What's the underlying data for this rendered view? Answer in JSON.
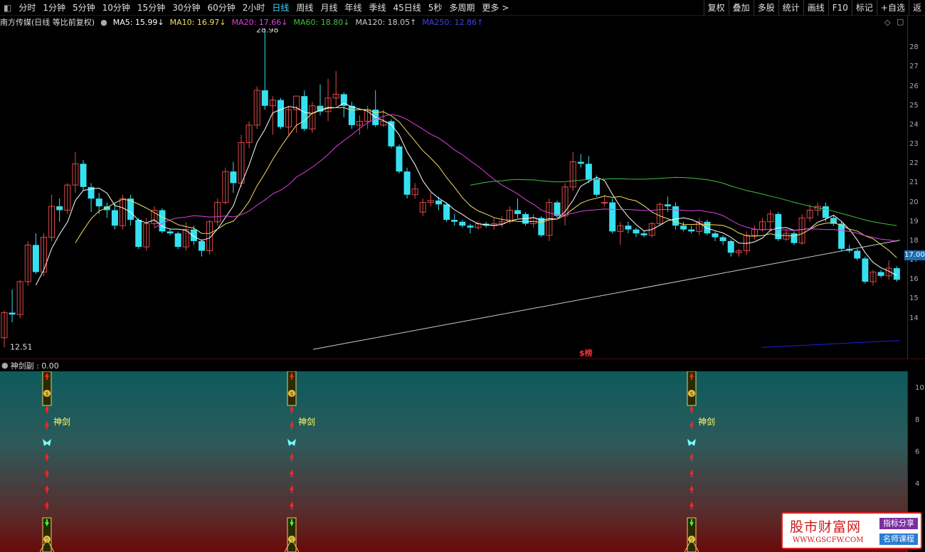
{
  "toolbar": {
    "periods": [
      "分时",
      "1分钟",
      "5分钟",
      "10分钟",
      "15分钟",
      "30分钟",
      "60分钟",
      "2小时",
      "日线",
      "周线",
      "月线",
      "年线",
      "季线",
      "45日线",
      "5秒",
      "多周期",
      "更多 >"
    ],
    "active": "日线",
    "right_buttons": [
      "复权",
      "叠加",
      "多股",
      "统计",
      "画线",
      "F10",
      "标记",
      "+自选",
      "返"
    ]
  },
  "legend": {
    "title": "南方传媒(日线 等比前复权)",
    "ma5": "MA5: 15.99↓",
    "ma10": "MA10: 16.97↓",
    "ma20": "MA20: 17.66↓",
    "ma60": "MA60: 18.80↓",
    "ma120": "MA120: 18.05↑",
    "ma250": "MA250: 12.86↑"
  },
  "colors": {
    "up": "#e04848",
    "down": "#36e0f0",
    "ma5": "#ffffff",
    "ma10": "#f0e060",
    "ma20": "#e040e0",
    "ma60": "#40c040",
    "ma120": "#cccccc",
    "ma250": "#2020e0"
  },
  "chart": {
    "high_label": "28.98",
    "low_label": "12.51",
    "current_price": "17.00",
    "event_marker": "$榜",
    "yaxis_ticks": [
      "28",
      "27",
      "26",
      "25",
      "24",
      "23",
      "22",
      "21",
      "20",
      "19",
      "18",
      "17",
      "16",
      "15",
      "14"
    ]
  },
  "sub": {
    "title": "神剑副 : 0.00",
    "sword_label": "神剑",
    "yaxis_ticks": [
      "10",
      "8",
      "6",
      "4"
    ]
  },
  "watermark": {
    "title": "股市财富网",
    "url": "WWW.GSCFW.COM",
    "tag1": "指标分享",
    "tag2": "名师课程"
  },
  "chart_data": {
    "type": "candlestick",
    "ylim": [
      12,
      29
    ],
    "candles": [
      [
        13.0,
        14.4,
        12.5,
        14.3
      ],
      [
        14.3,
        15.5,
        13.8,
        14.2
      ],
      [
        14.2,
        16.0,
        14.0,
        15.9
      ],
      [
        15.9,
        18.0,
        15.7,
        17.8
      ],
      [
        17.8,
        18.4,
        16.3,
        16.4
      ],
      [
        16.4,
        18.4,
        16.2,
        18.2
      ],
      [
        18.2,
        20.4,
        18.0,
        19.8
      ],
      [
        19.8,
        20.2,
        19.0,
        19.6
      ],
      [
        19.6,
        21.0,
        19.4,
        20.9
      ],
      [
        20.9,
        22.6,
        20.5,
        22.0
      ],
      [
        22.0,
        22.2,
        20.6,
        20.8
      ],
      [
        20.8,
        21.0,
        19.5,
        20.2
      ],
      [
        20.2,
        20.5,
        19.4,
        19.8
      ],
      [
        19.8,
        20.0,
        19.2,
        19.6
      ],
      [
        19.6,
        20.0,
        18.6,
        18.8
      ],
      [
        18.8,
        20.4,
        18.6,
        20.2
      ],
      [
        20.2,
        20.4,
        18.8,
        19.1
      ],
      [
        19.1,
        19.2,
        17.6,
        17.7
      ],
      [
        17.7,
        19.2,
        17.5,
        18.9
      ],
      [
        18.9,
        19.8,
        18.7,
        19.6
      ],
      [
        19.6,
        19.7,
        18.4,
        18.5
      ],
      [
        18.5,
        18.6,
        18.3,
        18.4
      ],
      [
        18.4,
        18.5,
        17.6,
        17.7
      ],
      [
        17.7,
        19.0,
        17.5,
        18.6
      ],
      [
        18.6,
        18.8,
        17.8,
        18.0
      ],
      [
        18.0,
        18.1,
        17.2,
        17.5
      ],
      [
        17.5,
        19.1,
        17.3,
        19.0
      ],
      [
        19.0,
        20.2,
        18.8,
        20.0
      ],
      [
        20.0,
        21.8,
        19.9,
        21.6
      ],
      [
        21.6,
        22.1,
        20.5,
        21.0
      ],
      [
        21.0,
        23.5,
        20.8,
        23.1
      ],
      [
        23.1,
        24.2,
        22.8,
        24.0
      ],
      [
        24.0,
        26.0,
        23.8,
        25.8
      ],
      [
        25.8,
        29.0,
        24.8,
        25.0
      ],
      [
        25.0,
        25.5,
        23.5,
        25.3
      ],
      [
        25.3,
        25.4,
        23.8,
        23.9
      ],
      [
        23.9,
        25.0,
        23.5,
        24.8
      ],
      [
        24.8,
        25.0,
        23.6,
        25.5
      ],
      [
        25.5,
        25.8,
        23.7,
        23.8
      ],
      [
        23.8,
        25.2,
        23.6,
        25.0
      ],
      [
        25.0,
        26.1,
        24.5,
        24.7
      ],
      [
        24.7,
        26.4,
        24.2,
        25.4
      ],
      [
        25.4,
        26.8,
        25.0,
        25.6
      ],
      [
        25.6,
        25.7,
        24.4,
        25.0
      ],
      [
        25.0,
        25.2,
        23.8,
        24.0
      ],
      [
        24.0,
        24.5,
        23.5,
        24.2
      ],
      [
        24.2,
        25.0,
        23.8,
        24.8
      ],
      [
        24.8,
        25.8,
        23.9,
        24.0
      ],
      [
        24.0,
        24.8,
        23.9,
        24.2
      ],
      [
        24.2,
        24.3,
        22.8,
        22.9
      ],
      [
        22.9,
        23.0,
        21.5,
        21.6
      ],
      [
        21.6,
        21.8,
        20.2,
        20.4
      ],
      [
        20.4,
        21.0,
        20.2,
        20.7
      ],
      [
        19.5,
        20.2,
        19.3,
        20.0
      ],
      [
        20.0,
        20.5,
        19.8,
        20.1
      ],
      [
        20.1,
        20.3,
        19.6,
        19.9
      ],
      [
        19.9,
        20.0,
        19.0,
        19.1
      ],
      [
        19.1,
        19.4,
        18.8,
        19.0
      ],
      [
        19.0,
        19.1,
        18.7,
        18.8
      ],
      [
        18.8,
        18.9,
        18.4,
        18.7
      ],
      [
        18.7,
        19.0,
        18.6,
        18.9
      ],
      [
        18.9,
        19.0,
        18.7,
        18.8
      ],
      [
        18.8,
        19.2,
        18.6,
        18.9
      ],
      [
        18.9,
        19.3,
        18.7,
        19.0
      ],
      [
        19.0,
        19.8,
        18.9,
        19.6
      ],
      [
        19.6,
        20.2,
        19.2,
        19.4
      ],
      [
        19.4,
        19.5,
        18.8,
        18.9
      ],
      [
        18.9,
        19.4,
        18.7,
        19.2
      ],
      [
        19.2,
        19.3,
        18.2,
        18.3
      ],
      [
        18.3,
        20.2,
        18.0,
        20.0
      ],
      [
        20.0,
        20.1,
        19.2,
        19.3
      ],
      [
        19.3,
        21.0,
        18.8,
        20.8
      ],
      [
        20.8,
        22.6,
        20.6,
        22.1
      ],
      [
        22.1,
        22.5,
        21.8,
        22.0
      ],
      [
        22.0,
        22.4,
        21.0,
        21.2
      ],
      [
        21.2,
        21.4,
        20.3,
        20.4
      ],
      [
        20.0,
        20.4,
        19.8,
        20.0
      ],
      [
        20.0,
        20.2,
        18.4,
        18.5
      ],
      [
        18.5,
        19.0,
        17.8,
        18.8
      ],
      [
        18.8,
        19.0,
        18.4,
        18.6
      ],
      [
        18.6,
        18.7,
        18.2,
        18.4
      ],
      [
        18.4,
        18.5,
        18.2,
        18.3
      ],
      [
        18.3,
        19.0,
        18.2,
        18.9
      ],
      [
        18.9,
        20.0,
        18.8,
        19.9
      ],
      [
        19.9,
        20.3,
        19.5,
        19.8
      ],
      [
        19.8,
        20.0,
        18.6,
        18.8
      ],
      [
        18.8,
        19.0,
        18.5,
        18.6
      ],
      [
        18.6,
        18.8,
        18.4,
        18.5
      ],
      [
        18.5,
        19.2,
        18.3,
        19.0
      ],
      [
        19.0,
        19.1,
        18.3,
        18.4
      ],
      [
        18.4,
        18.5,
        18.0,
        18.2
      ],
      [
        18.2,
        18.3,
        17.8,
        18.0
      ],
      [
        18.0,
        18.1,
        17.2,
        17.4
      ],
      [
        17.4,
        17.6,
        17.2,
        17.5
      ],
      [
        17.5,
        18.5,
        17.3,
        18.3
      ],
      [
        18.3,
        18.8,
        18.1,
        18.6
      ],
      [
        18.6,
        19.2,
        18.5,
        19.0
      ],
      [
        19.0,
        19.6,
        18.5,
        19.4
      ],
      [
        19.4,
        19.5,
        18.0,
        18.1
      ],
      [
        18.1,
        18.6,
        18.0,
        18.4
      ],
      [
        18.4,
        18.5,
        17.8,
        17.9
      ],
      [
        17.9,
        19.4,
        17.8,
        19.2
      ],
      [
        19.2,
        19.9,
        19.0,
        19.6
      ],
      [
        19.6,
        20.0,
        19.3,
        19.8
      ],
      [
        19.8,
        20.0,
        19.0,
        19.2
      ],
      [
        19.2,
        19.3,
        18.8,
        18.9
      ],
      [
        18.9,
        19.0,
        17.5,
        17.6
      ],
      [
        17.6,
        17.8,
        17.4,
        17.5
      ],
      [
        17.5,
        17.6,
        17.0,
        17.1
      ],
      [
        17.1,
        17.2,
        15.8,
        15.9
      ],
      [
        15.9,
        16.5,
        15.7,
        16.4
      ],
      [
        16.4,
        16.5,
        16.1,
        16.2
      ],
      [
        16.2,
        17.0,
        16.0,
        16.6
      ],
      [
        16.6,
        16.7,
        15.9,
        16.0
      ]
    ],
    "ma5_last": 15.99,
    "ma10_last": 16.97,
    "ma20_last": 17.66,
    "ma60_last": 18.8,
    "ma120_last": 18.05,
    "ma250_last": 12.86
  }
}
